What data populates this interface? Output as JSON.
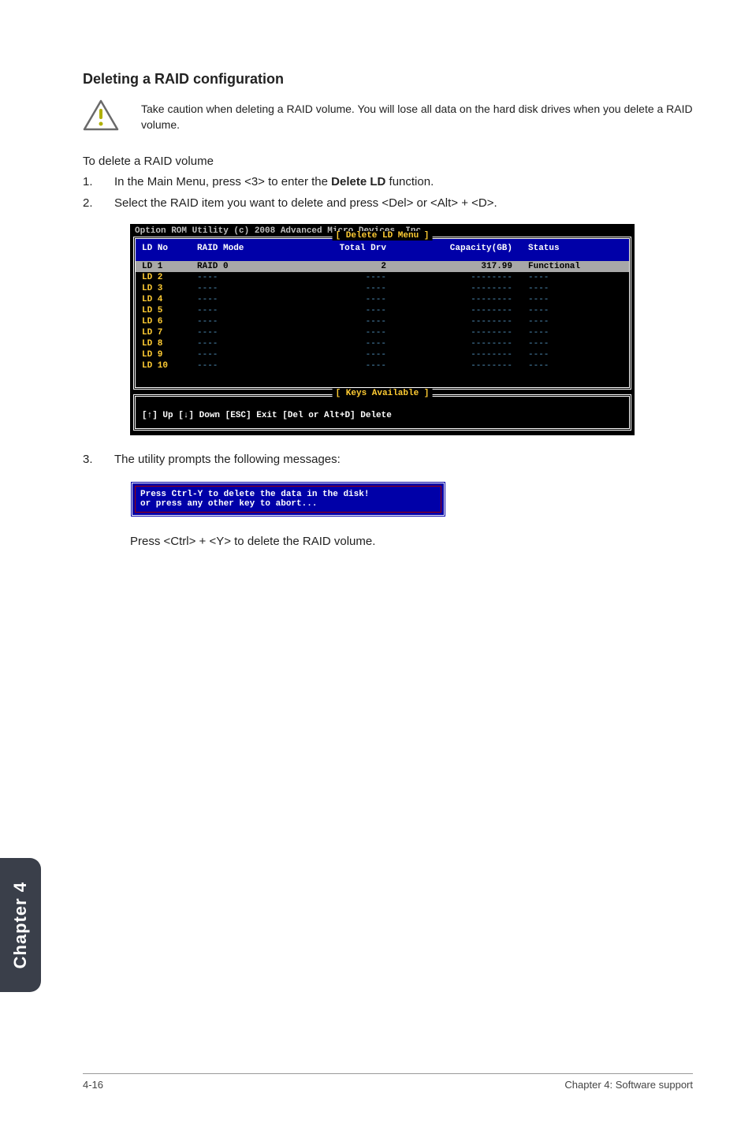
{
  "section": {
    "title": "Deleting a RAID configuration",
    "caution": "Take caution when deleting a RAID volume. You will lose all data on the hard disk drives when you delete a RAID volume.",
    "lead": "To delete a RAID volume",
    "step1_pre": "In the Main Menu, press <3> to enter the ",
    "step1_bold": "Delete LD",
    "step1_post": " function.",
    "step2": "Select the RAID item you want to delete and press <Del> or <Alt> + <D>.",
    "step3": "The utility prompts the following messages:",
    "closing": "Press <Ctrl> + <Y> to delete the RAID volume."
  },
  "bios": {
    "rom_title": "Option ROM Utility (c) 2008 Advanced Micro Devices, Inc.",
    "menu_label": "[ Delete LD Menu ]",
    "headers": {
      "ld": "LD No",
      "mode": "RAID Mode",
      "drv": "Total Drv",
      "cap": "Capacity(GB)",
      "status": "Status"
    },
    "selected": {
      "ld": "LD 1",
      "mode": "RAID 0",
      "drv": "2",
      "cap": "317.99",
      "status": "Functional"
    },
    "rows": [
      "LD 2",
      "LD 3",
      "LD 4",
      "LD 5",
      "LD 6",
      "LD 7",
      "LD 8",
      "LD 9",
      "LD 10"
    ],
    "dash4": "----",
    "dash8": "--------",
    "keys_label": "[ Keys Available ]",
    "keys_text": "[↑] Up [↓] Down [ESC] Exit [Del or Alt+D] Delete"
  },
  "confirm": {
    "line1": "Press Ctrl-Y to delete the data in the disk!",
    "line2": "or press any other key to abort..."
  },
  "sidebar": {
    "label": "Chapter 4"
  },
  "footer": {
    "page": "4-16",
    "chapter": "Chapter 4: Software support"
  },
  "chart_data": {
    "type": "table",
    "title": "Delete LD Menu",
    "columns": [
      "LD No",
      "RAID Mode",
      "Total Drv",
      "Capacity(GB)",
      "Status"
    ],
    "rows": [
      [
        "LD 1",
        "RAID 0",
        2,
        317.99,
        "Functional"
      ],
      [
        "LD 2",
        null,
        null,
        null,
        null
      ],
      [
        "LD 3",
        null,
        null,
        null,
        null
      ],
      [
        "LD 4",
        null,
        null,
        null,
        null
      ],
      [
        "LD 5",
        null,
        null,
        null,
        null
      ],
      [
        "LD 6",
        null,
        null,
        null,
        null
      ],
      [
        "LD 7",
        null,
        null,
        null,
        null
      ],
      [
        "LD 8",
        null,
        null,
        null,
        null
      ],
      [
        "LD 9",
        null,
        null,
        null,
        null
      ],
      [
        "LD 10",
        null,
        null,
        null,
        null
      ]
    ]
  }
}
